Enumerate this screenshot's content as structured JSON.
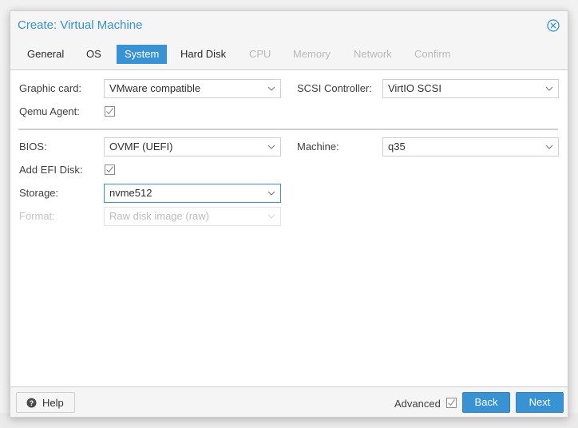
{
  "window": {
    "title": "Create: Virtual Machine"
  },
  "tabs": [
    {
      "label": "General",
      "state": "normal"
    },
    {
      "label": "OS",
      "state": "normal"
    },
    {
      "label": "System",
      "state": "active"
    },
    {
      "label": "Hard Disk",
      "state": "normal"
    },
    {
      "label": "CPU",
      "state": "disabled"
    },
    {
      "label": "Memory",
      "state": "disabled"
    },
    {
      "label": "Network",
      "state": "disabled"
    },
    {
      "label": "Confirm",
      "state": "disabled"
    }
  ],
  "form": {
    "graphic_card": {
      "label": "Graphic card:",
      "value": "VMware compatible"
    },
    "scsi_controller": {
      "label": "SCSI Controller:",
      "value": "VirtIO SCSI"
    },
    "qemu_agent": {
      "label": "Qemu Agent:",
      "checked": false
    },
    "bios": {
      "label": "BIOS:",
      "value": "OVMF (UEFI)"
    },
    "machine": {
      "label": "Machine:",
      "value": "q35"
    },
    "add_efi_disk": {
      "label": "Add EFI Disk:",
      "checked": false
    },
    "storage": {
      "label": "Storage:",
      "value": "nvme512"
    },
    "format": {
      "label": "Format:",
      "value": "Raw disk image (raw)",
      "disabled": true
    }
  },
  "footer": {
    "help_label": "Help",
    "advanced_label": "Advanced",
    "advanced_checked": false,
    "back_label": "Back",
    "next_label": "Next"
  },
  "colors": {
    "accent": "#3892d4",
    "border": "#cfcfcf",
    "disabled_text": "#b9b9b9"
  },
  "icons": {
    "close": "close-circle-icon",
    "help": "question-circle-icon",
    "dropdown": "chevron-down-icon"
  }
}
